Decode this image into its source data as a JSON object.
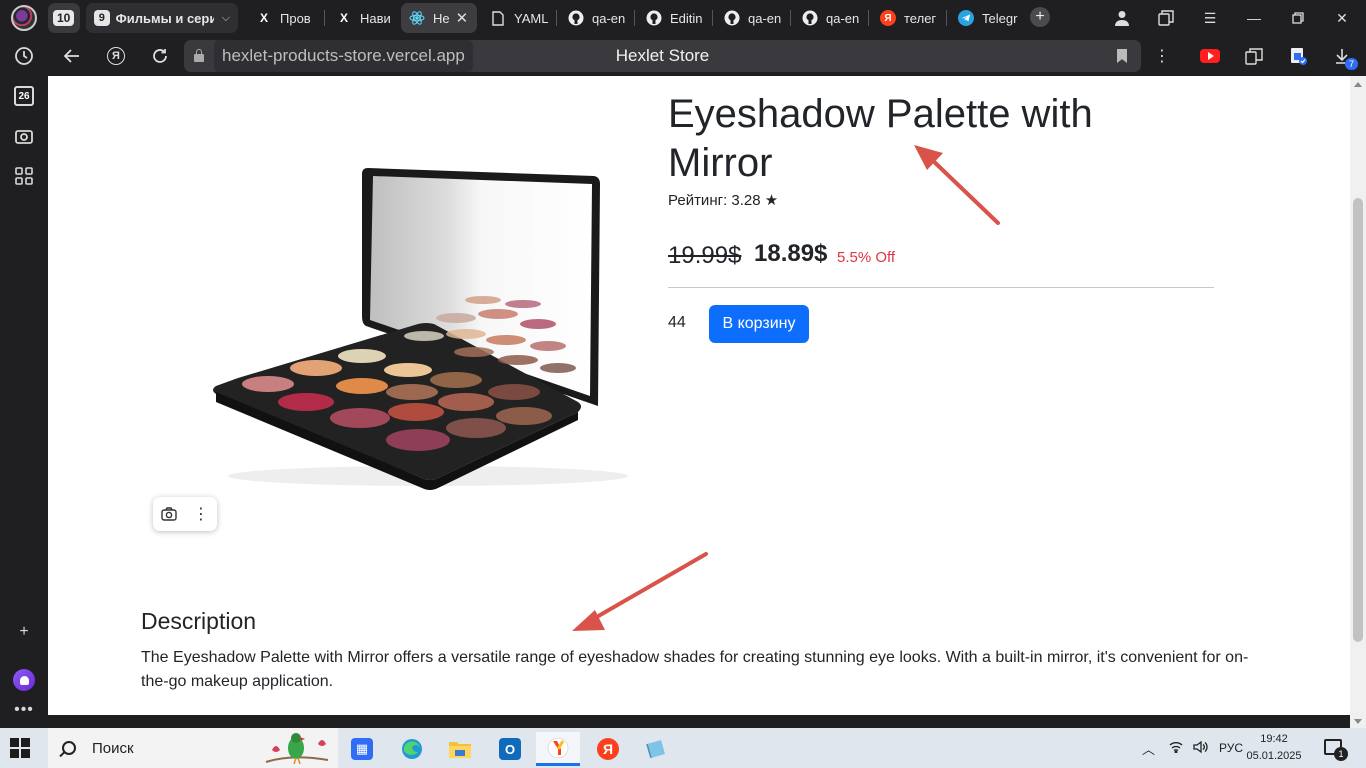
{
  "browser": {
    "tabs": [
      {
        "label": "10",
        "kind": "counter"
      },
      {
        "label": "Фильмы и сериал",
        "group_count": "9",
        "kind": "group"
      },
      {
        "label": "Пров",
        "icon": "hexlet-icon"
      },
      {
        "label": "Нави",
        "icon": "hexlet-icon"
      },
      {
        "label": "He",
        "icon": "react-icon",
        "active": true
      },
      {
        "label": "YAML",
        "icon": "document-icon"
      },
      {
        "label": "qa-en",
        "icon": "github-icon"
      },
      {
        "label": "Editin",
        "icon": "github-icon"
      },
      {
        "label": "qa-en",
        "icon": "github-icon"
      },
      {
        "label": "qa-en",
        "icon": "github-icon"
      },
      {
        "label": "телег",
        "icon": "yandex-icon"
      },
      {
        "label": "Telegr",
        "icon": "telegram-icon"
      }
    ],
    "url": "hexlet-products-store.vercel.app",
    "page_title": "Hexlet Store",
    "downloads_badge": "7",
    "sidebar_date": "26"
  },
  "product": {
    "title": "Eyeshadow Palette with Mirror",
    "rating": "Рейтинг: 3.28 ★",
    "old_price": "19.99$",
    "price": "18.89$",
    "discount": "5.5% Off",
    "stock": "44",
    "cart_button": "В корзину",
    "description_title": "Description",
    "description": "The Eyeshadow Palette with Mirror offers a versatile range of eyeshadow shades for creating stunning eye looks. With a built-in mirror, it's convenient for on-the-go makeup application."
  },
  "taskbar": {
    "search_label": "Поиск",
    "language": "РУС",
    "time": "19:42",
    "date": "05.01.2025",
    "notifications": "1"
  },
  "colors": {
    "accent": "#0d6efd",
    "discount": "#dc3545",
    "annotation_arrow": "#d9534a"
  }
}
